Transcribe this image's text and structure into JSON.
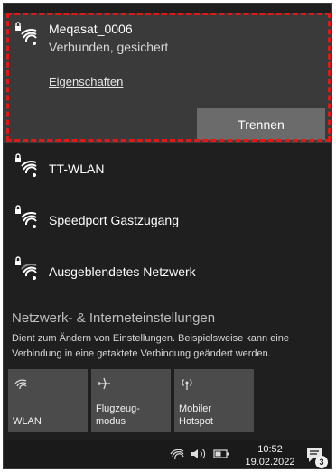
{
  "connected_network": {
    "name": "Meqasat_0006",
    "status": "Verbunden, gesichert",
    "properties_link": "Eigenschaften",
    "disconnect_button": "Trennen"
  },
  "networks": [
    {
      "name": "TT-WLAN",
      "icon": "wifi-secured-icon"
    },
    {
      "name": "Speedport Gastzugang",
      "icon": "wifi-secured-icon"
    },
    {
      "name": "Ausgeblendetes Netzwerk",
      "icon": "wifi-secured-icon"
    }
  ],
  "settings": {
    "title": "Netzwerk- & Interneteinstellungen",
    "description": "Dient zum Ändern von Einstellungen. Beispielsweise kann eine Verbindung in eine getaktete Verbindung geändert werden."
  },
  "quick_actions": [
    {
      "label": "WLAN",
      "icon": "wifi-icon"
    },
    {
      "label": "Flugzeug-\nmodus",
      "icon": "airplane-icon"
    },
    {
      "label": "Mobiler\nHotspot",
      "icon": "hotspot-icon"
    }
  ],
  "taskbar": {
    "time": "10:52",
    "date": "19.02.2022",
    "notification_count": "3"
  },
  "colors": {
    "highlight": "#e01818",
    "flyout_bg": "#1f1f1f",
    "connected_bg": "#3a3a3a",
    "tile_bg": "#4b4b4b"
  }
}
